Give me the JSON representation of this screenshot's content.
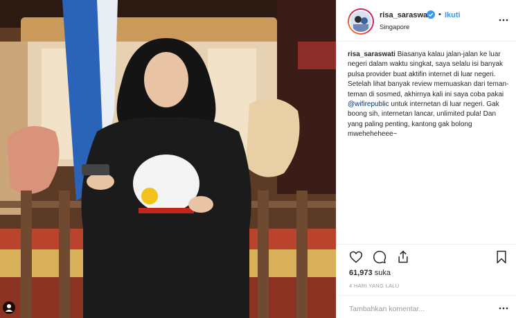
{
  "post": {
    "username": "risa_saraswati",
    "follow_label": "Ikuti",
    "dot": "•",
    "location": "Singapore",
    "caption_user": "risa_saraswati",
    "caption_part1": "Biasanya kalau jalan-jalan ke luar negeri dalam waktu singkat, saya selalu isi banyak pulsa provider buat aktifin internet di luar negeri. Setelah lihat banyak review memuaskan dari teman-teman di sosmed, akhirnya kali ini saya coba pakai",
    "caption_mention": "@wifirepublic",
    "caption_part2": "untuk internetan di luar negeri. Gak boong sih, internetan lancar, unlimited pula! Dan yang paling penting, kantong gak bolong mweheheheee~",
    "likes_count": "61,973",
    "likes_label": "suka",
    "time_ago": "4 HARI YANG LALU",
    "comment_placeholder": "Tambahkan komentar..."
  },
  "colors": {
    "link_blue": "#3897f0",
    "mention_blue": "#003569",
    "text": "#262626",
    "muted": "#999999",
    "border": "#efefef"
  },
  "icons": {
    "verified": "verified-badge-icon",
    "more": "more-options-icon",
    "like": "heart-icon",
    "comment": "comment-bubble-icon",
    "share": "share-icon",
    "save": "bookmark-icon",
    "user_tag": "person-icon"
  }
}
